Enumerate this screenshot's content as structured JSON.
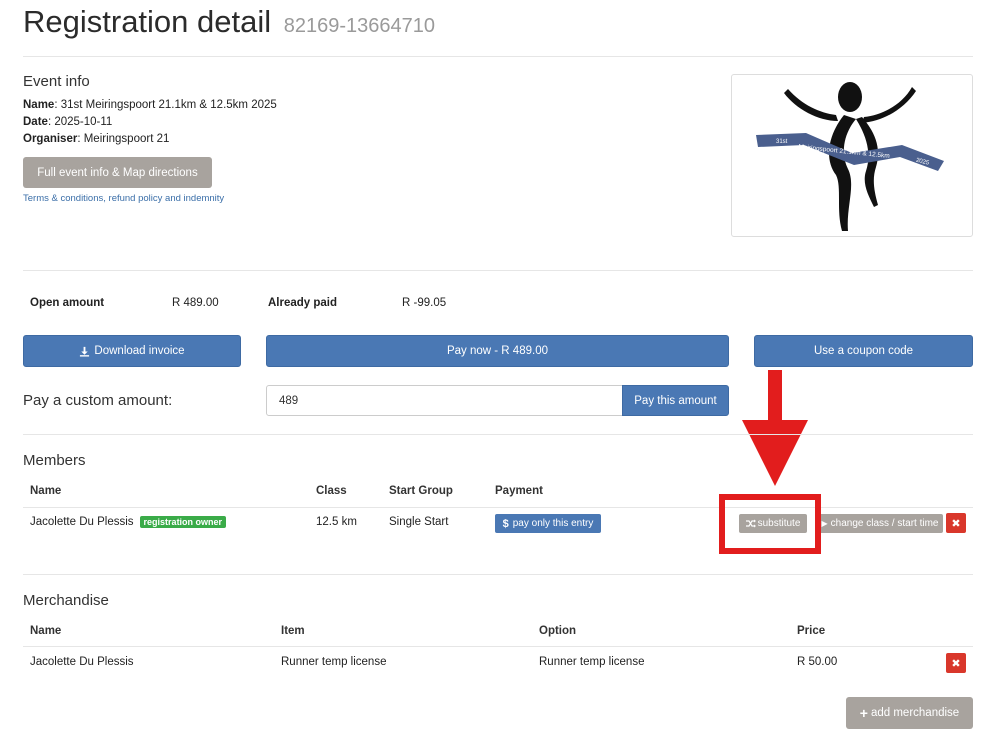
{
  "header": {
    "title": "Registration detail",
    "reg_number": "82169-13664710"
  },
  "event_info": {
    "section_title": "Event info",
    "name_label": "Name",
    "name_value": ": 31st Meiringspoort 21.1km & 12.5km 2025",
    "date_label": "Date",
    "date_value": ": 2025-10-11",
    "organiser_label": "Organiser",
    "organiser_value": ": Meiringspoort 21",
    "full_info_button": "Full event info & Map directions",
    "terms_link": "Terms & conditions, refund policy and indemnity",
    "logo": {
      "line1": "31st",
      "line2": "Meiringspoort 21.1km & 12.5km",
      "line3": "2025"
    }
  },
  "amounts": {
    "open_label": "Open amount",
    "open_value": "R 489.00",
    "paid_label": "Already paid",
    "paid_value": "R -99.05"
  },
  "actions": {
    "download_invoice": "Download invoice",
    "pay_now": "Pay now - R 489.00",
    "coupon": "Use a coupon code"
  },
  "custom_payment": {
    "label": "Pay a custom amount:",
    "value": "489",
    "button": "Pay this amount"
  },
  "members": {
    "section_title": "Members",
    "columns": [
      "Name",
      "Class",
      "Start Group",
      "Payment"
    ],
    "rows": [
      {
        "name": "Jacolette Du Plessis",
        "badge": "registration owner",
        "class": "12.5 km",
        "start_group": "Single Start",
        "pay_button": "pay only this entry",
        "substitute_button": "substitute",
        "change_button": "change class / start time",
        "delete_button": "✖"
      }
    ]
  },
  "merchandise": {
    "section_title": "Merchandise",
    "columns": [
      "Name",
      "Item",
      "Option",
      "Price"
    ],
    "rows": [
      {
        "name": "Jacolette Du Plessis",
        "item": "Runner temp license",
        "option": "Runner temp license",
        "price": "R 50.00",
        "delete_button": "✖"
      }
    ],
    "add_button": "add merchandise"
  },
  "annotation": {
    "color": "#e21d1d"
  }
}
